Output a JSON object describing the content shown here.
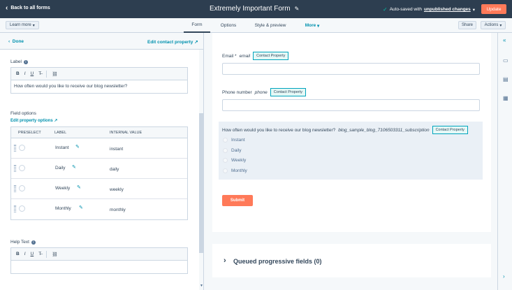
{
  "topbar": {
    "back_label": "Back to all forms",
    "form_title": "Extremely Important Form",
    "autosave_prefix": "Auto-saved with",
    "autosave_link": "unpublished changes",
    "update_label": "Update"
  },
  "subnav": {
    "learn_more": "Learn more",
    "tabs": [
      {
        "label": "Form",
        "active": true
      },
      {
        "label": "Options",
        "active": false
      },
      {
        "label": "Style & preview",
        "active": false
      },
      {
        "label": "More",
        "active": false
      }
    ],
    "share_label": "Share",
    "actions_label": "Actions"
  },
  "left": {
    "done_label": "Done",
    "edit_property_label": "Edit contact property",
    "label_caption": "Label",
    "label_value": "How often would you like to receive our blog newsletter?",
    "field_options_caption": "Field options",
    "edit_property_options": "Edit property options",
    "table_headers": {
      "preselect": "PRESELECT",
      "label": "LABEL",
      "internal": "INTERNAL VALUE"
    },
    "options": [
      {
        "label": "Instant",
        "internal": "instant"
      },
      {
        "label": "Daily",
        "internal": "daily"
      },
      {
        "label": "Weekly",
        "internal": "weekly"
      },
      {
        "label": "Monthly",
        "internal": "monthly"
      }
    ],
    "help_text_caption": "Help Text",
    "help_text_value": ""
  },
  "preview": {
    "email": {
      "label": "Email *",
      "internal": "email",
      "badge": "Contact Property"
    },
    "phone": {
      "label": "Phone number",
      "internal": "phone",
      "badge": "Contact Property"
    },
    "question": {
      "label": "How often would you like to receive our blog newsletter?",
      "internal": "blog_sample_blog_7106503311_subscription",
      "badge": "Contact Property",
      "options": [
        "Instant",
        "Daily",
        "Weekly",
        "Monthly"
      ]
    },
    "submit_label": "Submit",
    "queued_label": "Queued progressive fields (0)"
  },
  "icons": {
    "back": "chevron-left-icon",
    "edit": "pencil-icon",
    "check": "check-icon",
    "info": "info-icon",
    "collapse": "double-chevron-left-icon",
    "chat": "chat-icon"
  }
}
